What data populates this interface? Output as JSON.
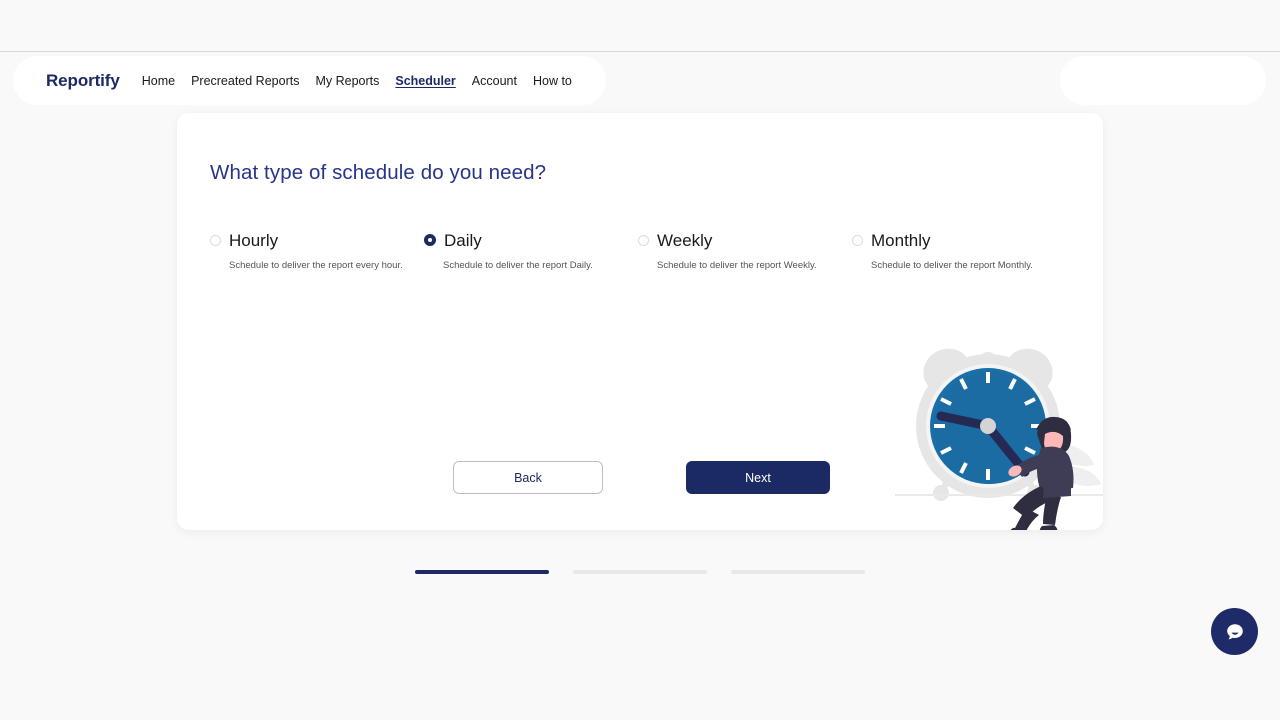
{
  "nav": {
    "brand": "Reportify",
    "links": [
      {
        "label": "Home",
        "active": false
      },
      {
        "label": "Precreated Reports",
        "active": false
      },
      {
        "label": "My Reports",
        "active": false
      },
      {
        "label": "Scheduler",
        "active": true
      },
      {
        "label": "Account",
        "active": false
      },
      {
        "label": "How to",
        "active": false
      }
    ]
  },
  "card": {
    "title": "What type of schedule do you need?",
    "options": [
      {
        "label": "Hourly",
        "description": "Schedule to deliver the report every hour.",
        "selected": false
      },
      {
        "label": "Daily",
        "description": "Schedule to deliver the report Daily.",
        "selected": true
      },
      {
        "label": "Weekly",
        "description": "Schedule to deliver the report Weekly.",
        "selected": false
      },
      {
        "label": "Monthly",
        "description": "Schedule to deliver the report Monthly.",
        "selected": false
      }
    ],
    "back_label": "Back",
    "next_label": "Next"
  },
  "stepper": {
    "steps": [
      {
        "active": true
      },
      {
        "active": false
      },
      {
        "active": false
      }
    ]
  },
  "colors": {
    "brand_navy": "#1c2a63",
    "heading_blue": "#27348b",
    "clock_blue": "#1a6fa8",
    "page_bg": "#f9f9f9",
    "card_bg": "#ffffff",
    "step_inactive": "#e8e8e8"
  }
}
